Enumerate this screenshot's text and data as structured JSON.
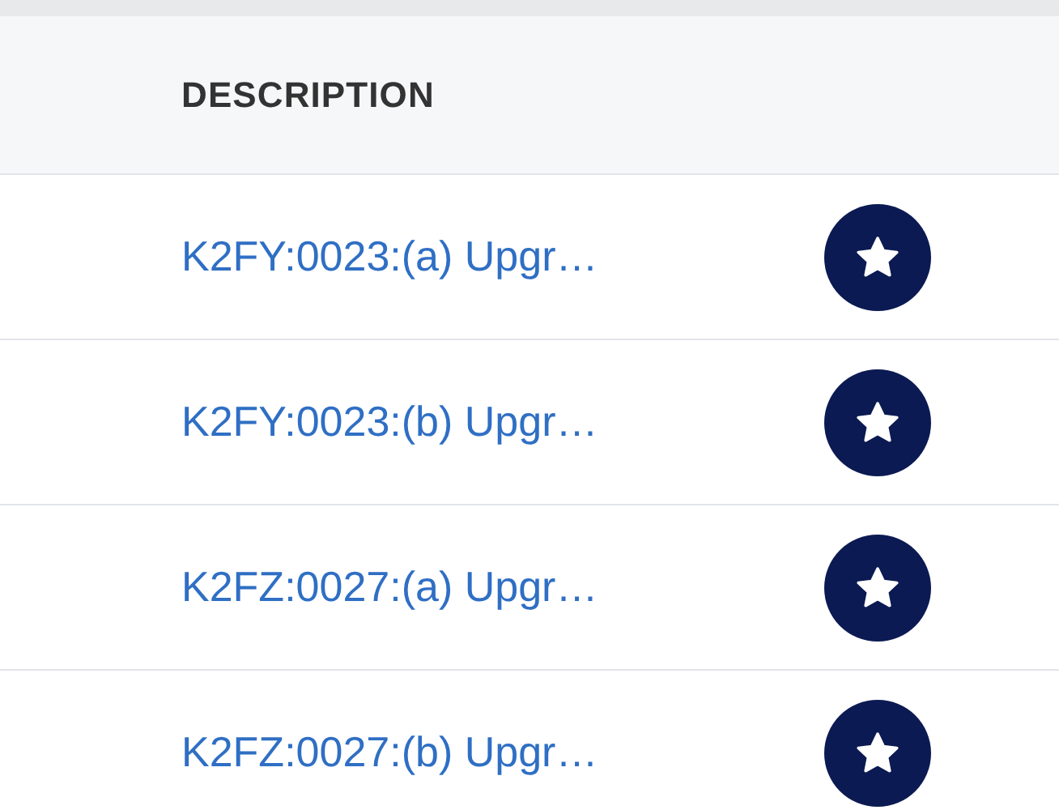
{
  "table": {
    "columns": [
      "DESCRIPTION"
    ],
    "rows": [
      {
        "description": "K2FY:0023:(a) Upgr…"
      },
      {
        "description": "K2FY:0023:(b) Upgr…"
      },
      {
        "description": "K2FZ:0027:(a) Upgr…"
      },
      {
        "description": "K2FZ:0027:(b) Upgr…"
      }
    ]
  }
}
